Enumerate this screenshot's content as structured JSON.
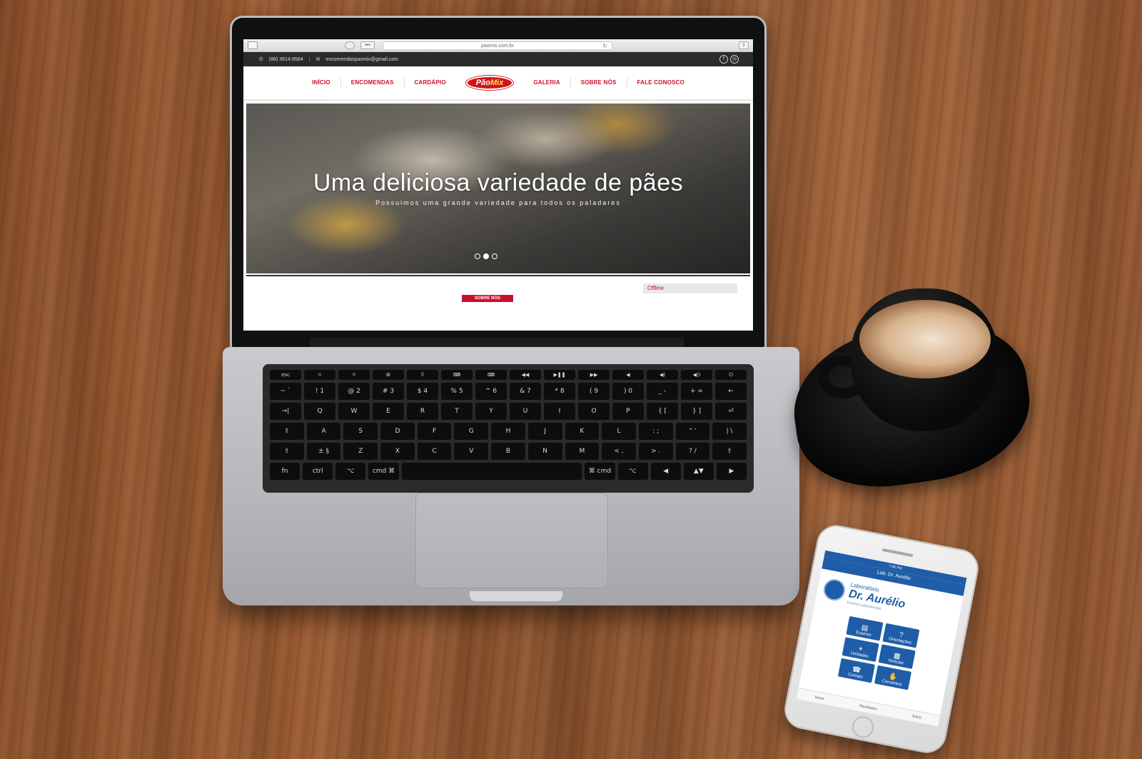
{
  "browser": {
    "url": "paomix.com.br",
    "dots_label": "•••",
    "reload_glyph": "↻",
    "share_glyph": "⇪"
  },
  "site": {
    "topbar": {
      "phone_icon": "✆",
      "phone": "(88) 3614-9584",
      "separator": "|",
      "email_icon": "✉",
      "email": "encomendaspaomix@gmail.com",
      "social": [
        "f",
        "◎"
      ]
    },
    "nav": {
      "items_left": [
        "INÍCIO",
        "ENCOMENDAS",
        "CARDÁPIO"
      ],
      "logo_pao": "Pão",
      "logo_mix": "Mix",
      "items_right": [
        "GALERIA",
        "SOBRE NÓS",
        "FALE CONOSCO"
      ]
    },
    "hero": {
      "title": "Uma deliciosa variedade de pães",
      "subtitle": "Possuimos uma grande variedade para todos os paladares",
      "slides": 3,
      "active_slide": 2
    },
    "section_tab": "SOBRE NÓS",
    "chat_status": "Offline"
  },
  "keyboard": {
    "fn_row": [
      "esc",
      "☼",
      "☼",
      "⊞",
      "⠿",
      "⌨",
      "⌨",
      "◀◀",
      "▶❚❚",
      "▶▶",
      "◀",
      "◀)",
      "◀))",
      "⏻"
    ],
    "row1": [
      "~ `",
      "! 1",
      "@ 2",
      "# 3",
      "$ 4",
      "% 5",
      "^ 6",
      "& 7",
      "* 8",
      "( 9",
      ") 0",
      "_ -",
      "+ =",
      "←"
    ],
    "row2": [
      "→|",
      "Q",
      "W",
      "E",
      "R",
      "T",
      "Y",
      "U",
      "I",
      "O",
      "P",
      "{ [",
      "} ]",
      "⏎"
    ],
    "row3": [
      "⇪",
      "A",
      "S",
      "D",
      "F",
      "G",
      "H",
      "J",
      "K",
      "L",
      ": ;",
      "\" '",
      "| \\"
    ],
    "row4": [
      "⇧",
      "± §",
      "Z",
      "X",
      "C",
      "V",
      "B",
      "N",
      "M",
      "< ,",
      "> .",
      "? /",
      "⇧"
    ],
    "row5": [
      "fn",
      "ctrl",
      "⌥",
      "cmd ⌘",
      " ",
      "⌘ cmd",
      "⌥",
      "◀",
      "▲▼",
      "▶"
    ]
  },
  "phone": {
    "status": "7:46 PM",
    "nav_title": "Lab. Dr. Aurélio",
    "lab_line1": "Laboratório",
    "lab_line2": "Dr. Aurélio",
    "lab_line3": "Exames Laboratoriais",
    "tiles": [
      {
        "icon": "▤",
        "label": "Exames"
      },
      {
        "icon": "?",
        "label": "Orientações"
      },
      {
        "icon": "⌖",
        "label": "Unidades"
      },
      {
        "icon": "▦",
        "label": "Notícias"
      },
      {
        "icon": "☎",
        "label": "Contato"
      },
      {
        "icon": "✋",
        "label": "Convênios"
      }
    ],
    "tabs": [
      "Home",
      "Resultados",
      "Sobre"
    ]
  },
  "colors": {
    "brand_red": "#c8102e",
    "logo_yellow": "#ffe34d",
    "lab_blue": "#1f5da8"
  }
}
